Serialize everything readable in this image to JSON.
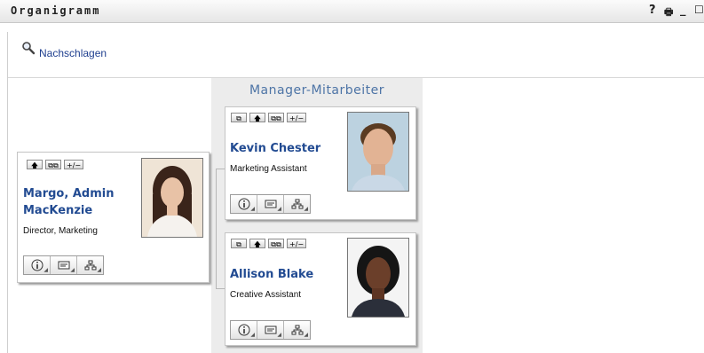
{
  "window": {
    "title": "Organigramm",
    "controls": [
      "?",
      "🖶",
      "_",
      "☐"
    ]
  },
  "lookup": {
    "label": "Nachschlagen",
    "icon": "magnifier-icon"
  },
  "manager_panel": {
    "header": "Manager-Mitarbeiter"
  },
  "cards": {
    "root": {
      "name": "Margo, Admin MacKenzie",
      "title": "Director, Marketing",
      "buttons": [
        "🡅",
        "⧉⧉",
        "+/−"
      ]
    },
    "emp1": {
      "name": "Kevin Chester",
      "title": "Marketing Assistant",
      "buttons": [
        "⧉",
        "🡅",
        "⧉⧉",
        "+/−"
      ]
    },
    "emp2": {
      "name": "Allison Blake",
      "title": "Creative Assistant",
      "buttons": [
        "⧉",
        "🡅",
        "⧉⧉",
        "+/−"
      ]
    }
  },
  "action_icons": [
    "info-icon",
    "email-icon",
    "org-chart-icon"
  ],
  "colors": {
    "name_blue": "#224b92",
    "header_blue": "#4d74a6",
    "link_blue": "#1f3f8f"
  }
}
